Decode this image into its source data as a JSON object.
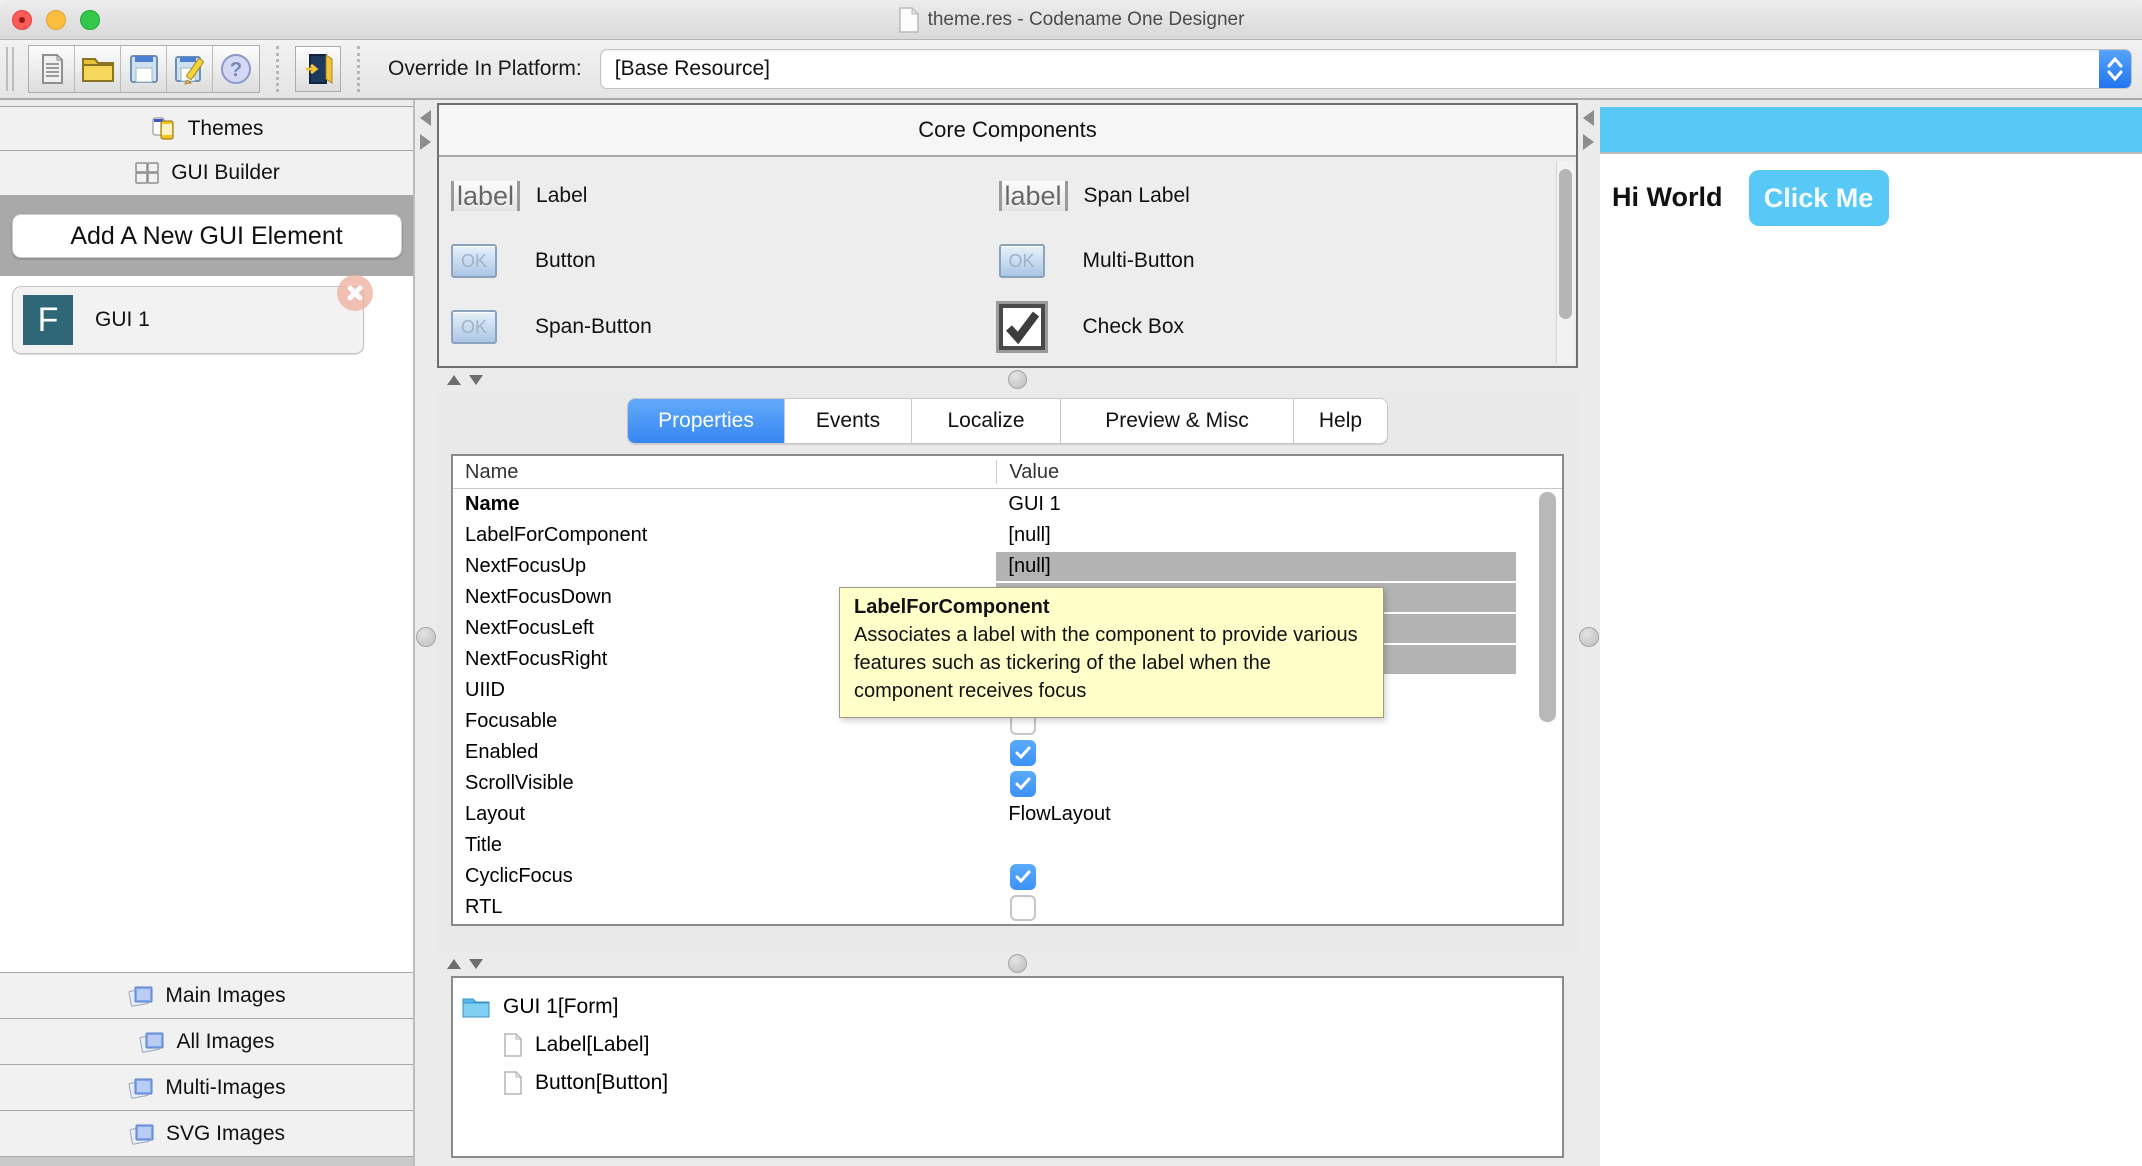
{
  "window": {
    "title": "theme.res - Codename One Designer"
  },
  "toolbar": {
    "icons": [
      "new-document",
      "open-folder",
      "save",
      "save-as-edit",
      "help",
      "exit-door"
    ],
    "override_label": "Override In Platform:",
    "combo_value": "[Base Resource]"
  },
  "sidebar": {
    "themes": "Themes",
    "gui_builder": "GUI Builder",
    "add_new": "Add A New GUI Element",
    "gui_item": {
      "initial": "F",
      "label": "GUI 1"
    },
    "images": [
      "Main Images",
      "All Images",
      "Multi-Images",
      "SVG Images"
    ]
  },
  "core": {
    "title": "Core Components",
    "glyphs": {
      "label": "label",
      "ok": "OK"
    },
    "items": [
      {
        "icon": "label-glyph",
        "label": "Label"
      },
      {
        "icon": "label-glyph",
        "label": "Span Label"
      },
      {
        "icon": "ok-button-glyph",
        "label": "Button"
      },
      {
        "icon": "ok-button-glyph",
        "label": "Multi-Button"
      },
      {
        "icon": "ok-button-glyph",
        "label": "Span-Button"
      },
      {
        "icon": "checkbox-glyph",
        "label": "Check Box"
      }
    ]
  },
  "tabs": [
    "Properties",
    "Events",
    "Localize",
    "Preview & Misc",
    "Help"
  ],
  "active_tab": "Properties",
  "props": {
    "columns": [
      "Name",
      "Value"
    ],
    "rows": [
      {
        "name": "Name",
        "value": "GUI 1",
        "type": "text",
        "bold": true
      },
      {
        "name": "LabelForComponent",
        "value": "[null]",
        "type": "text"
      },
      {
        "name": "NextFocusUp",
        "value": "[null]",
        "type": "text",
        "highlighted": true
      },
      {
        "name": "NextFocusDown",
        "value": "",
        "type": "text",
        "highlighted": true
      },
      {
        "name": "NextFocusLeft",
        "value": "",
        "type": "text",
        "highlighted": true
      },
      {
        "name": "NextFocusRight",
        "value": "",
        "type": "text",
        "highlighted": true
      },
      {
        "name": "UIID",
        "value": "",
        "type": "text"
      },
      {
        "name": "Focusable",
        "type": "checkbox",
        "checked": false
      },
      {
        "name": "Enabled",
        "type": "checkbox",
        "checked": true
      },
      {
        "name": "ScrollVisible",
        "type": "checkbox",
        "checked": true
      },
      {
        "name": "Layout",
        "value": "FlowLayout",
        "type": "text"
      },
      {
        "name": "Title",
        "value": "",
        "type": "text"
      },
      {
        "name": "CyclicFocus",
        "type": "checkbox",
        "checked": true
      },
      {
        "name": "RTL",
        "type": "checkbox",
        "checked": false
      }
    ]
  },
  "tooltip": {
    "title": "LabelForComponent",
    "body": "Associates a label with the component to provide various features such as tickering of the label when the component receives focus"
  },
  "tree": {
    "root": "GUI 1[Form]",
    "children": [
      "Label[Label]",
      "Button[Button]"
    ]
  },
  "preview": {
    "label": "Hi World",
    "button": "Click Me"
  },
  "colors": {
    "accent_blue": "#3b8cf5",
    "preview_blue": "#57c7f6",
    "tooltip_bg": "#ffffca",
    "highlight_gray": "#b3b3b3",
    "checkbox_blue": "#3b92f8",
    "form_badge_teal": "#2e6878"
  }
}
